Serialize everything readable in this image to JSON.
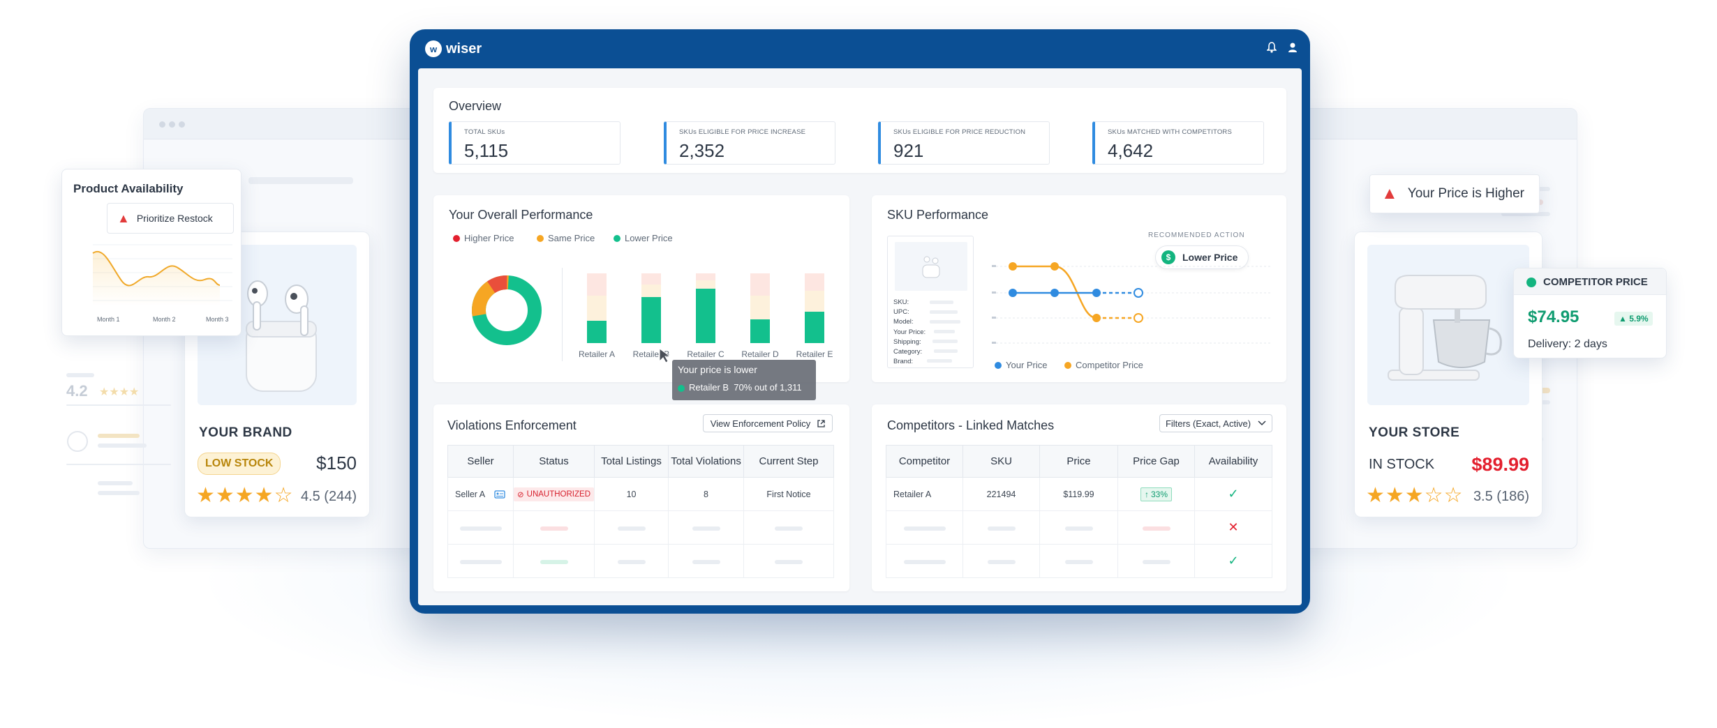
{
  "app": {
    "brand": "wiser"
  },
  "overview": {
    "title": "Overview",
    "kpis": [
      {
        "label": "TOTAL SKUs",
        "value": "5,115"
      },
      {
        "label": "SKUs ELIGIBLE FOR PRICE INCREASE",
        "value": "2,352"
      },
      {
        "label": "SKUs ELIGIBLE FOR PRICE REDUCTION",
        "value": "921"
      },
      {
        "label": "SKUs MATCHED WITH COMPETITORS",
        "value": "4,642"
      }
    ]
  },
  "performance": {
    "title": "Your Overall Performance",
    "legend": [
      "Higher Price",
      "Same Price",
      "Lower Price"
    ],
    "retailers": [
      "Retailer A",
      "Retailer B",
      "Retailer C",
      "Retailer D",
      "Retailer E"
    ],
    "tooltip": {
      "title": "Your price is lower",
      "detail": "Retailer B  70% out of 1,311"
    }
  },
  "chart_data": {
    "type": "bar",
    "categories": [
      "Retailer A",
      "Retailer B",
      "Retailer C",
      "Retailer D",
      "Retailer E"
    ],
    "series": [
      {
        "name": "Lower Price",
        "values": [
          32,
          66,
          78,
          34,
          45
        ]
      },
      {
        "name": "Same Price",
        "values": [
          36,
          18,
          12,
          34,
          30
        ]
      },
      {
        "name": "Higher Price",
        "values": [
          32,
          16,
          10,
          32,
          25
        ]
      }
    ],
    "colors": {
      "Higher Price": "#e94f3b",
      "Same Price": "#f6a623",
      "Lower Price": "#13c08d"
    }
  },
  "sku_performance": {
    "title": "SKU Performance",
    "recommended_label": "RECOMMENDED ACTION",
    "recommended_action": "Lower Price",
    "fields": [
      "SKU:",
      "UPC:",
      "Model:",
      "Your Price:",
      "Shipping:",
      "Category:",
      "Brand:"
    ],
    "legend": [
      "Your Price",
      "Competitor Price"
    ]
  },
  "violations": {
    "title": "Violations Enforcement",
    "button": "View Enforcement Policy",
    "headers": [
      "Seller",
      "Status",
      "Total Listings",
      "Total Violations",
      "Current Step"
    ],
    "row": {
      "seller": "Seller A",
      "status": "UNAUTHORIZED",
      "listings": "10",
      "violations": "8",
      "step": "First Notice"
    }
  },
  "competitors": {
    "title": "Competitors - Linked Matches",
    "filter": "Filters (Exact, Active)",
    "headers": [
      "Competitor",
      "SKU",
      "Price",
      "Price Gap",
      "Availability"
    ],
    "row": {
      "competitor": "Retailer A",
      "sku": "221494",
      "price": "$119.99",
      "gap": "33%"
    }
  },
  "availability_card": {
    "title": "Product Availability",
    "alert": "Prioritize Restock",
    "months": [
      "Month 1",
      "Month 2",
      "Month 3"
    ]
  },
  "left_product": {
    "brand": "YOUR BRAND",
    "badge": "LOW STOCK",
    "price": "$150",
    "rating": "4.5 (244)",
    "stars": "★★★★☆",
    "faded_rating": "4.2"
  },
  "right_product": {
    "alert": "Your Price is Higher",
    "store": "YOUR STORE",
    "stock": "IN STOCK",
    "price": "$89.99",
    "rating": "3.5 (186)",
    "stars": "★★★☆☆"
  },
  "competitor_card": {
    "title": "COMPETITOR PRICE",
    "price": "$74.95",
    "change": "▲ 5.9%",
    "delivery": "Delivery: 2 days"
  }
}
